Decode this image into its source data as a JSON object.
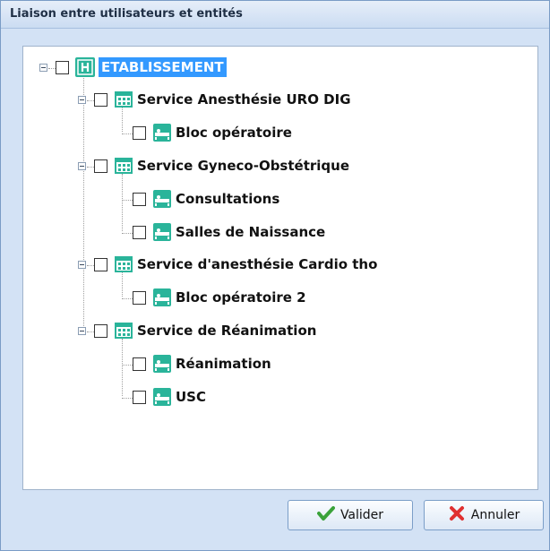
{
  "window": {
    "title": "Liaison entre utilisateurs et entités"
  },
  "tree": {
    "root": {
      "label": "ETABLISSEMENT",
      "icon": "hospital-icon"
    },
    "services": [
      {
        "label": "Service Anesthésie URO DIG",
        "icon": "building-icon",
        "children": [
          {
            "label": "Bloc opératoire",
            "icon": "bed-icon"
          }
        ]
      },
      {
        "label": "Service Gyneco-Obstétrique",
        "icon": "building-icon",
        "children": [
          {
            "label": "Consultations",
            "icon": "bed-icon"
          },
          {
            "label": "Salles de Naissance",
            "icon": "bed-icon"
          }
        ]
      },
      {
        "label": "Service d'anesthésie Cardio tho",
        "icon": "building-icon",
        "children": [
          {
            "label": "Bloc opératoire 2",
            "icon": "bed-icon"
          }
        ]
      },
      {
        "label": "Service de Réanimation",
        "icon": "building-icon",
        "children": [
          {
            "label": "Réanimation",
            "icon": "bed-icon"
          },
          {
            "label": "USC",
            "icon": "bed-icon"
          }
        ]
      }
    ]
  },
  "buttons": {
    "validate": "Valider",
    "cancel": "Annuler"
  },
  "colors": {
    "selection": "#3399ff",
    "icon_teal": "#2ab49a"
  }
}
